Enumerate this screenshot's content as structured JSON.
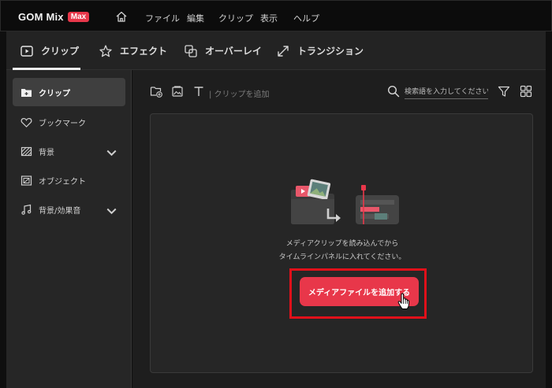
{
  "app": {
    "logo_text": "GOM Mix",
    "logo_badge": "Max",
    "brand_color": "#e8374a"
  },
  "menu": {
    "items": [
      "ファイル",
      "編集",
      "クリップ",
      "表示",
      "ヘルプ"
    ]
  },
  "tabs": [
    {
      "label": "クリップ",
      "icon": "clip-icon",
      "active": true
    },
    {
      "label": "エフェクト",
      "icon": "star-icon"
    },
    {
      "label": "オーバーレイ",
      "icon": "overlay-icon"
    },
    {
      "label": "トランジション",
      "icon": "transition-icon"
    }
  ],
  "sidebar": {
    "items": [
      {
        "label": "クリップ",
        "icon": "folder-icon",
        "active": true
      },
      {
        "label": "ブックマーク",
        "icon": "heart-icon"
      },
      {
        "label": "背景",
        "icon": "background-icon",
        "expandable": true
      },
      {
        "label": "オブジェクト",
        "icon": "object-icon"
      },
      {
        "label": "背景/効果音",
        "icon": "music-icon",
        "expandable": true
      }
    ]
  },
  "toolbar": {
    "add_clip_label": "| クリップを追加",
    "search_placeholder": "検索語を入力してください。"
  },
  "drop_area": {
    "message_line1": "メディアクリップを読み込んでから",
    "message_line2": "タイムラインパネルに入れてください。",
    "add_button_label": "メディアファイルを追加する"
  }
}
